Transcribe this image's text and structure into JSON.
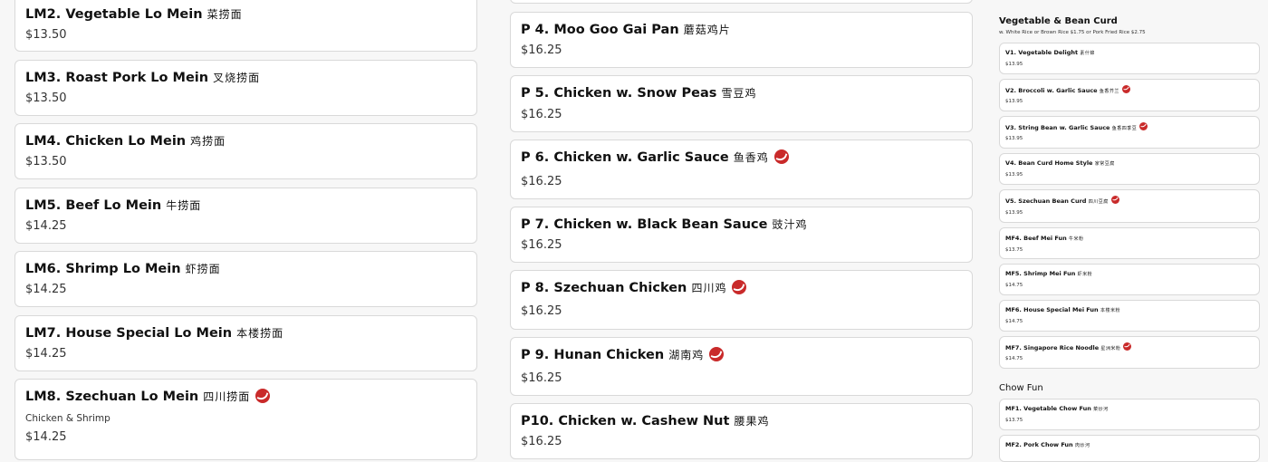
{
  "lo_mein": [
    {
      "name": "LM2. Vegetable Lo Mein",
      "cjk": "菜捞面",
      "price": "$13.50",
      "spicy": false
    },
    {
      "name": "LM3. Roast Pork Lo Mein",
      "cjk": "叉烧捞面",
      "price": "$13.50",
      "spicy": false
    },
    {
      "name": "LM4. Chicken Lo Mein",
      "cjk": "鸡捞面",
      "price": "$13.50",
      "spicy": false
    },
    {
      "name": "LM5. Beef Lo Mein",
      "cjk": "牛捞面",
      "price": "$14.25",
      "spicy": false
    },
    {
      "name": "LM6. Shrimp Lo Mein",
      "cjk": "虾捞面",
      "price": "$14.25",
      "spicy": false
    },
    {
      "name": "LM7. House Special Lo Mein",
      "cjk": "本楼捞面",
      "price": "$14.25",
      "spicy": false
    },
    {
      "name": "LM8. Szechuan Lo Mein",
      "cjk": "四川捞面",
      "note": "Chicken & Shrimp",
      "price": "$14.25",
      "spicy": true
    }
  ],
  "poultry": [
    {
      "name": "P 4. Moo Goo Gai Pan",
      "cjk": "蘑菇鸡片",
      "price": "$16.25",
      "spicy": false
    },
    {
      "name": "P 5. Chicken w. Snow Peas",
      "cjk": "雪豆鸡",
      "price": "$16.25",
      "spicy": false
    },
    {
      "name": "P 6. Chicken w. Garlic Sauce",
      "cjk": "鱼香鸡",
      "price": "$16.25",
      "spicy": true
    },
    {
      "name": "P 7. Chicken w. Black Bean Sauce",
      "cjk": "豉汁鸡",
      "price": "$16.25",
      "spicy": false
    },
    {
      "name": "P 8. Szechuan Chicken",
      "cjk": "四川鸡",
      "price": "$16.25",
      "spicy": true
    },
    {
      "name": "P 9. Hunan Chicken",
      "cjk": "湖南鸡",
      "price": "$16.25",
      "spicy": true
    },
    {
      "name": "P10. Chicken w. Cashew Nut",
      "cjk": "腰果鸡",
      "price": "$16.25",
      "spicy": false
    }
  ],
  "bean_curd": {
    "title": "Vegetable & Bean Curd",
    "subtitle": "w. White Rice or Brown Rice $1.75 or Pork Fried Rice $2.75",
    "items": [
      {
        "name": "V1. Vegetable Delight",
        "cjk": "素什锦",
        "price": "$13.95",
        "spicy": false
      },
      {
        "name": "V2. Broccoli w. Garlic Sauce",
        "cjk": "鱼香芥兰",
        "price": "$13.95",
        "spicy": true
      },
      {
        "name": "V3. String Bean w. Garlic Sauce",
        "cjk": "鱼香四季豆",
        "price": "$13.95",
        "spicy": true
      },
      {
        "name": "V4. Bean Curd Home Style",
        "cjk": "家常豆腐",
        "price": "$13.95",
        "spicy": false
      },
      {
        "name": "V5. Szechuan Bean Curd",
        "cjk": "四川豆腐",
        "price": "$13.95",
        "spicy": true
      },
      {
        "name": "MF4. Beef Mei Fun",
        "cjk": "牛米粉",
        "price": "$13.75",
        "spicy": false
      },
      {
        "name": "MF5. Shrimp Mei Fun",
        "cjk": "虾米粉",
        "price": "$14.75",
        "spicy": false
      },
      {
        "name": "MF6. House Special Mei Fun",
        "cjk": "本楼米粉",
        "price": "$14.75",
        "spicy": false
      },
      {
        "name": "MF7. Singapore Rice Noodle",
        "cjk": "星洲米粉",
        "price": "$14.75",
        "spicy": true
      }
    ]
  },
  "chow_fun": {
    "title": "Chow Fun",
    "items": [
      {
        "name": "MF1. Vegetable Chow Fun",
        "cjk": "菜炒河",
        "price": "$13.75",
        "spicy": false
      },
      {
        "name": "MF2. Pork Chow Fun",
        "cjk": "肉炒河",
        "price": "",
        "spicy": false
      }
    ]
  }
}
